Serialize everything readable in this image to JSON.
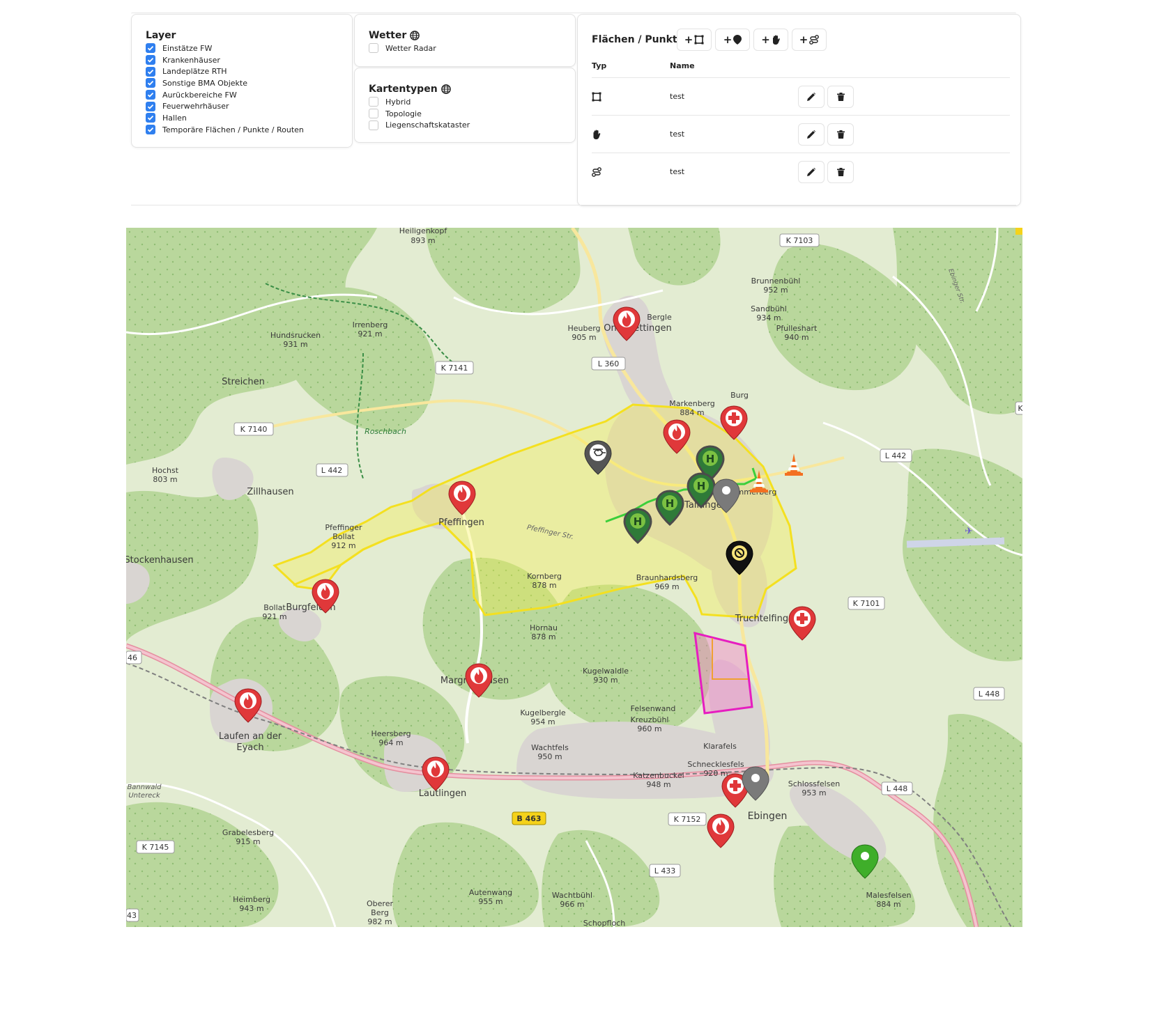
{
  "layer": {
    "title": "Layer",
    "items": [
      {
        "label": "Einstätze FW",
        "checked": true
      },
      {
        "label": "Krankenhäuser",
        "checked": true
      },
      {
        "label": "Landeplätze RTH",
        "checked": true
      },
      {
        "label": "Sonstige BMA Objekte",
        "checked": true
      },
      {
        "label": "Aurückbereiche FW",
        "checked": true
      },
      {
        "label": "Feuerwehrhäuser",
        "checked": true
      },
      {
        "label": "Hallen",
        "checked": true
      },
      {
        "label": "Temporäre Flächen / Punkte / Routen",
        "checked": true
      }
    ]
  },
  "weather": {
    "title": "Wetter",
    "items": [
      {
        "label": "Wetter Radar",
        "checked": false
      }
    ]
  },
  "maptypes": {
    "title": "Kartentypen",
    "items": [
      {
        "label": "Hybrid",
        "checked": false
      },
      {
        "label": "Topologie",
        "checked": false
      },
      {
        "label": "Liegenschaftskataster",
        "checked": false
      }
    ]
  },
  "features": {
    "title": "Flächen / Punkte",
    "add_buttons": [
      "+",
      "+",
      "+",
      "+"
    ],
    "col_type": "Typ",
    "col_name": "Name",
    "rows": [
      {
        "type_icon": "polygon-icon",
        "name": "test"
      },
      {
        "type_icon": "hand-icon",
        "name": "test"
      },
      {
        "type_icon": "route-icon",
        "name": "test"
      }
    ]
  },
  "map": {
    "labels": {
      "heiligenkopf": "Heiligenkopf",
      "heiligenkopf_h": "893 m",
      "k7103": "K 7103",
      "brunnenbuhl": "Brunnenbühl",
      "brunnenbuhl_h": "952 m",
      "sandbuhl": "Sandbühl",
      "sandbuhl_h": "934 m",
      "pfulleshart": "Pfulleshart",
      "pfulleshart_h": "940 m",
      "hundsrucken": "Hundsrucken",
      "hundsrucken_h": "931 m",
      "irrenberg": "Irrenberg",
      "irrenberg_h": "921 m",
      "heuberg": "Heuberg",
      "heuberg_h": "905 m",
      "bergle": "Bergle",
      "onstmettingen": "Onstmettingen",
      "streichen": "Streichen",
      "k7141": "K 7141",
      "l360": "L 360",
      "markenberg": "Markenberg",
      "markenberg_h": "884 m",
      "burg": "Burg",
      "k7140": "K 7140",
      "roschbach": "Roschbach",
      "hochst": "Hochst",
      "hochst_h": "803 m",
      "l442a": "L 442",
      "l442b": "L 442",
      "zillhausen": "Zillhausen",
      "pfeffingen": "Pfeffingen",
      "pfefferstr": "Pfeffinger Str.",
      "tailfingen": "Tailfingen",
      "lammerberg": "Lammerberg",
      "pfeffinger_bollat": "Pfeffinger",
      "bollat": "Bollat",
      "bollat_h": "912 m",
      "stockenhausen": "Stockenhausen",
      "kornberg": "Kornberg",
      "kornberg_h": "878 m",
      "braunhardsberg": "Braunhardsberg",
      "braunhardsberg_h": "969 m",
      "bollat2": "Bollat",
      "bollat2_h": "921 m",
      "burgfelden": "Burgfelden",
      "k7101": "K 7101",
      "truchtelfingen": "Truchtelfingen",
      "hornau": "Hornau",
      "hornau_h": "878 m",
      "r46": "46",
      "margrethausen": "Margrethausen",
      "kugelwaldle": "Kugelwaldle",
      "kugelwaldle_h": "930 m",
      "l448a": "L 448",
      "felsenwand": "Felsenwand",
      "kreuzbuhl": "Kreuzbühl",
      "kreuzbuhl_h": "960 m",
      "kugelbergle": "Kugelbergle",
      "kugelbergle_h": "954 m",
      "laufen": "Laufen an der",
      "eyach": "Eyach",
      "heersberg": "Heersberg",
      "heersberg_h": "964 m",
      "wachtfels": "Wachtfels",
      "wachtfels_h": "950 m",
      "klarafels": "Klarafels",
      "schnecklesfels": "Schnecklesfels",
      "schnecklesfels_h": "920 m",
      "katzenbuckel": "Katzenbuckel",
      "katzenbuckel_h": "948 m",
      "schlossfelsen": "Schlossfelsen",
      "schlossfelsen_h": "953 m",
      "l448b": "L 448",
      "bannwald": "Bannwald",
      "untereck": "Untereck",
      "lautlingen": "Lautlingen",
      "b463": "B 463",
      "k7152": "K 7152",
      "ebingen": "Ebingen",
      "grabelesberg": "Grabelesberg",
      "grabelesberg_h": "915 m",
      "k7145": "K 7145",
      "l433": "L 433",
      "heimberg": "Heimberg",
      "heimberg_h": "943 m",
      "autenwang": "Autenwang",
      "autenwang_h": "955 m",
      "wachtbuhl": "Wachtbühl",
      "wachtbuhl_h": "966 m",
      "oberer": "Oberer",
      "berg": "Berg",
      "berg_h": "982 m",
      "malesfelsen": "Malesfelsen",
      "malesfelsen_h": "884 m",
      "schopfloch": "Schopfloch",
      "r43": "43",
      "ebingerstr": "Ebinger Str.",
      "kfrag": "K"
    }
  }
}
